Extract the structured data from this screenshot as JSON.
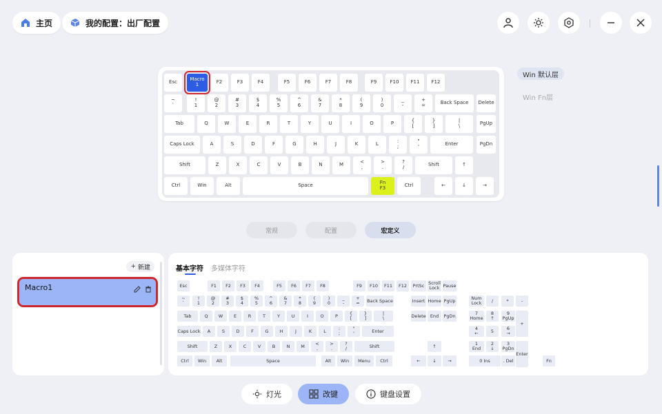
{
  "header": {
    "home_label": "主页",
    "config_label": "我的配置：出厂配置"
  },
  "window_icons": [
    "user-icon",
    "brightness-icon",
    "settings-hex-icon",
    "minimize-icon",
    "close-icon"
  ],
  "layers": {
    "active": "Win 默认层",
    "inactive": "Win Fn层"
  },
  "mode_tabs": [
    "常规",
    "配置",
    "宏定义"
  ],
  "macro": {
    "new_label": "新建",
    "item_name": "Macro1"
  },
  "char_tabs": {
    "basic": "基本字符",
    "media": "多媒体字符"
  },
  "bottom_nav": {
    "light": "灯光",
    "remap": "改键",
    "settings": "键盘设置"
  },
  "colors": {
    "accent": "#2d5be3",
    "fn_key": "#dcf11c",
    "highlight": "#d0262d",
    "macro_item": "#9bb5f7"
  },
  "top_keys": [
    {
      "t": "Esc"
    },
    {
      "t": "Macro",
      "s": "1"
    },
    {
      "t": "F2"
    },
    {
      "t": "F3"
    },
    {
      "t": "F4"
    },
    {
      "t": "F5"
    },
    {
      "t": "F6"
    },
    {
      "t": "F7"
    },
    {
      "t": "F8"
    },
    {
      "t": "F9"
    },
    {
      "t": "F10"
    },
    {
      "t": "F11"
    },
    {
      "t": "F12"
    },
    {
      "t": "~",
      "s": "`"
    },
    {
      "t": "!",
      "s": "1"
    },
    {
      "t": "@",
      "s": "2"
    },
    {
      "t": "#",
      "s": "3"
    },
    {
      "t": "$",
      "s": "4"
    },
    {
      "t": "%",
      "s": "5"
    },
    {
      "t": "^",
      "s": "6"
    },
    {
      "t": "&",
      "s": "7"
    },
    {
      "t": "*",
      "s": "8"
    },
    {
      "t": "(",
      "s": "9"
    },
    {
      "t": ")",
      "s": "0"
    },
    {
      "t": "_",
      "s": "-"
    },
    {
      "t": "+",
      "s": "="
    },
    {
      "t": "Back Space"
    },
    {
      "t": "Delete"
    },
    {
      "t": "Tab"
    },
    {
      "t": "Q"
    },
    {
      "t": "W"
    },
    {
      "t": "E"
    },
    {
      "t": "R"
    },
    {
      "t": "T"
    },
    {
      "t": "Y"
    },
    {
      "t": "U"
    },
    {
      "t": "I"
    },
    {
      "t": "O"
    },
    {
      "t": "P"
    },
    {
      "t": "{",
      "s": "["
    },
    {
      "t": "}",
      "s": "]"
    },
    {
      "t": "|",
      "s": "\\"
    },
    {
      "t": "PgUp"
    },
    {
      "t": "Caps Lock"
    },
    {
      "t": "A"
    },
    {
      "t": "S"
    },
    {
      "t": "D"
    },
    {
      "t": "F"
    },
    {
      "t": "G"
    },
    {
      "t": "H"
    },
    {
      "t": "J"
    },
    {
      "t": "K"
    },
    {
      "t": "L"
    },
    {
      "t": ":",
      "s": ";"
    },
    {
      "t": "\"",
      "s": "'"
    },
    {
      "t": "Enter"
    },
    {
      "t": "PgDn"
    },
    {
      "t": "Shift"
    },
    {
      "t": "Z"
    },
    {
      "t": "X"
    },
    {
      "t": "C"
    },
    {
      "t": "V"
    },
    {
      "t": "B"
    },
    {
      "t": "N"
    },
    {
      "t": "M"
    },
    {
      "t": "<",
      "s": ","
    },
    {
      "t": ">",
      "s": "."
    },
    {
      "t": "?",
      "s": "/"
    },
    {
      "t": "Shift"
    },
    {
      "t": "↑"
    },
    {
      "t": "Ctrl"
    },
    {
      "t": "Win"
    },
    {
      "t": "Alt"
    },
    {
      "t": "Space"
    },
    {
      "t": "Fn",
      "s": "F3"
    },
    {
      "t": "Ctrl"
    },
    {
      "t": "←"
    },
    {
      "t": "↓"
    },
    {
      "t": "→"
    }
  ],
  "char_keys": [
    {
      "t": "Esc"
    },
    {
      "t": "F1"
    },
    {
      "t": "F2"
    },
    {
      "t": "F3"
    },
    {
      "t": "F4"
    },
    {
      "t": "F5"
    },
    {
      "t": "F6"
    },
    {
      "t": "F7"
    },
    {
      "t": "F8"
    },
    {
      "t": "F9"
    },
    {
      "t": "F10"
    },
    {
      "t": "F11"
    },
    {
      "t": "F12"
    },
    {
      "t": "PrtSc"
    },
    {
      "t": "Scroll",
      "s": "Lock"
    },
    {
      "t": "Pause"
    },
    {
      "t": "~",
      "s": "`"
    },
    {
      "t": "!",
      "s": "1"
    },
    {
      "t": "@",
      "s": "2"
    },
    {
      "t": "#",
      "s": "3"
    },
    {
      "t": "$",
      "s": "4"
    },
    {
      "t": "%",
      "s": "5"
    },
    {
      "t": "^",
      "s": "6"
    },
    {
      "t": "&",
      "s": "7"
    },
    {
      "t": "*",
      "s": "8"
    },
    {
      "t": "(",
      "s": "9"
    },
    {
      "t": ")",
      "s": "0"
    },
    {
      "t": "_",
      "s": "-"
    },
    {
      "t": "+",
      "s": "="
    },
    {
      "t": "Back Space"
    },
    {
      "t": "Insert"
    },
    {
      "t": "Home"
    },
    {
      "t": "PgUp"
    },
    {
      "t": "Num",
      "s": "Lock"
    },
    {
      "t": "/"
    },
    {
      "t": "*"
    },
    {
      "t": "-"
    },
    {
      "t": "Tab"
    },
    {
      "t": "Q"
    },
    {
      "t": "W"
    },
    {
      "t": "E"
    },
    {
      "t": "R"
    },
    {
      "t": "T"
    },
    {
      "t": "Y"
    },
    {
      "t": "U"
    },
    {
      "t": "I"
    },
    {
      "t": "O"
    },
    {
      "t": "P"
    },
    {
      "t": "{",
      "s": "["
    },
    {
      "t": "}",
      "s": "]"
    },
    {
      "t": "|",
      "s": "\\"
    },
    {
      "t": "Delete"
    },
    {
      "t": "End"
    },
    {
      "t": "PgDn"
    },
    {
      "t": "7",
      "s": "Home"
    },
    {
      "t": "8",
      "s": "↑"
    },
    {
      "t": "9",
      "s": "PgUp"
    },
    {
      "t": "+"
    },
    {
      "t": "Caps Lock"
    },
    {
      "t": "A"
    },
    {
      "t": "S"
    },
    {
      "t": "D"
    },
    {
      "t": "F"
    },
    {
      "t": "G"
    },
    {
      "t": "H"
    },
    {
      "t": "J"
    },
    {
      "t": "K"
    },
    {
      "t": "L"
    },
    {
      "t": ":",
      "s": ";"
    },
    {
      "t": "\"",
      "s": "'"
    },
    {
      "t": "Enter"
    },
    {
      "t": "4",
      "s": "←"
    },
    {
      "t": "5"
    },
    {
      "t": "6",
      "s": "→"
    },
    {
      "t": "Shift"
    },
    {
      "t": "Z"
    },
    {
      "t": "X"
    },
    {
      "t": "C"
    },
    {
      "t": "V"
    },
    {
      "t": "B"
    },
    {
      "t": "N"
    },
    {
      "t": "M"
    },
    {
      "t": "<",
      "s": ","
    },
    {
      "t": ">",
      "s": "."
    },
    {
      "t": "?",
      "s": "/"
    },
    {
      "t": "Shift"
    },
    {
      "t": "↑"
    },
    {
      "t": "1",
      "s": "End"
    },
    {
      "t": "2",
      "s": "↓"
    },
    {
      "t": "3",
      "s": "PgDn"
    },
    {
      "t": "Enter"
    },
    {
      "t": "Ctrl"
    },
    {
      "t": "Win"
    },
    {
      "t": "Alt"
    },
    {
      "t": "Space"
    },
    {
      "t": "Alt"
    },
    {
      "t": "Win"
    },
    {
      "t": "Menu"
    },
    {
      "t": "Ctrl"
    },
    {
      "t": "←"
    },
    {
      "t": "↓"
    },
    {
      "t": "→"
    },
    {
      "t": "0 Ins"
    },
    {
      "t": ". Del"
    },
    {
      "t": "Fn"
    }
  ]
}
